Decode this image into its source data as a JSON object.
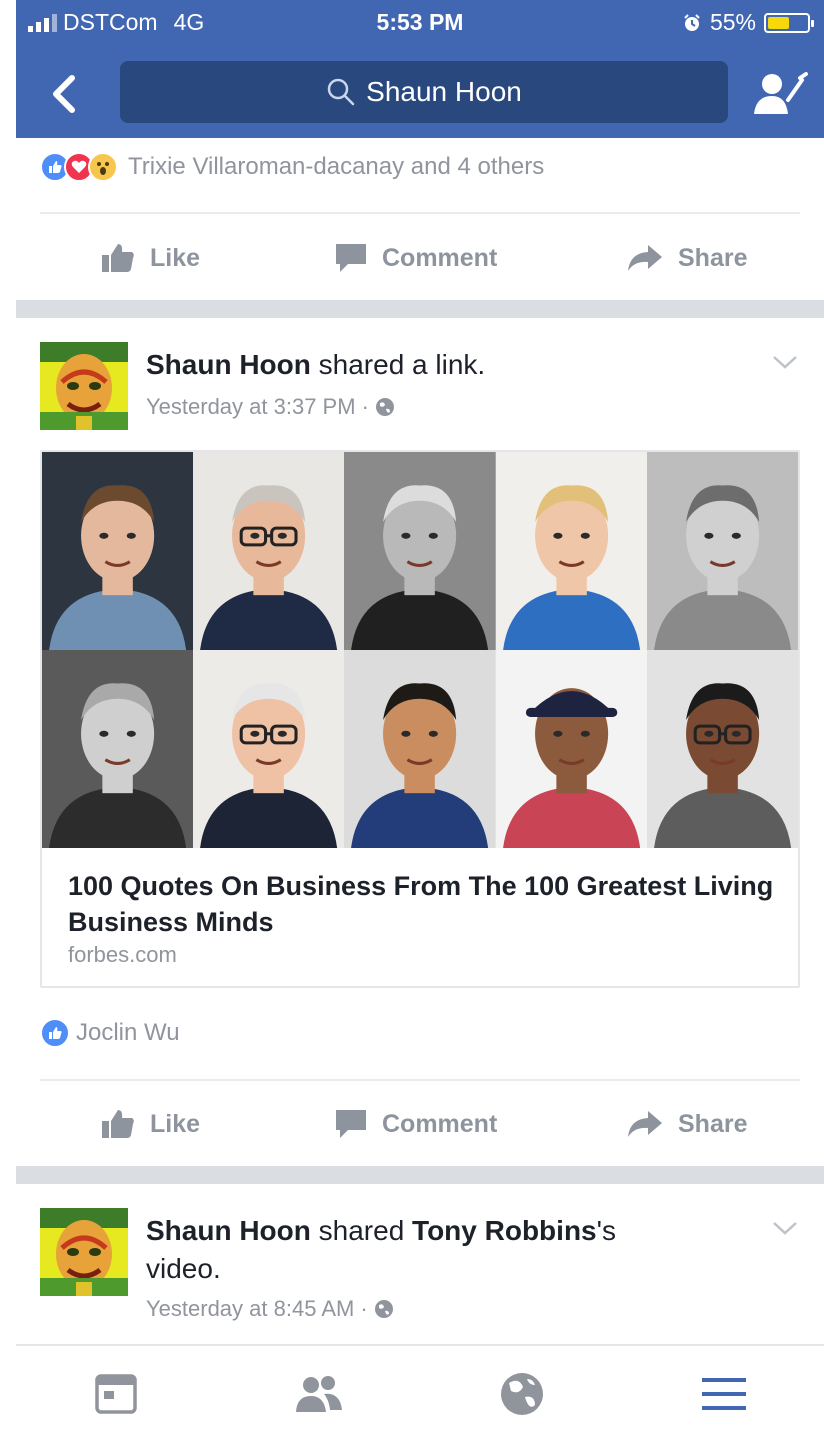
{
  "status_bar": {
    "carrier": "DSTCom",
    "network": "4G",
    "time": "5:53 PM",
    "battery_percent": "55%",
    "battery_level": 0.55,
    "icons": [
      "signal-icon",
      "alarm-icon",
      "battery-icon"
    ]
  },
  "header": {
    "search_text": "Shaun Hoon",
    "icons": [
      "back-arrow-icon",
      "search-icon",
      "friend-request-icon"
    ],
    "color": "#4267b2"
  },
  "feed": {
    "first_post_footer": {
      "reactions_text": "Trixie Villaroman-dacanay and 4 others",
      "reaction_icons": [
        "like-reaction-icon",
        "love-reaction-icon",
        "wow-reaction-icon"
      ],
      "actions": [
        "Like",
        "Comment",
        "Share"
      ]
    },
    "post_link": {
      "author": "Shaun Hoon",
      "verb": " shared a link.",
      "timestamp": "Yesterday at 3:37 PM ·",
      "link": {
        "title": "100 Quotes On Business From The 100 Greatest Living Business Minds",
        "domain": "forbes.com"
      },
      "reactions_text": "Joclin Wu",
      "actions": [
        "Like",
        "Comment",
        "Share"
      ]
    },
    "post_video": {
      "author": "Shaun Hoon",
      "verb": " shared ",
      "shared_from": "Tony Robbins",
      "suffix": "'s",
      "suffix2": "video.",
      "timestamp": "Yesterday at 8:45 AM ·"
    }
  },
  "tabbar": {
    "icons": [
      "news-feed-icon",
      "friends-icon",
      "globe-icon",
      "menu-icon"
    ],
    "active_color": "#4267b2"
  }
}
